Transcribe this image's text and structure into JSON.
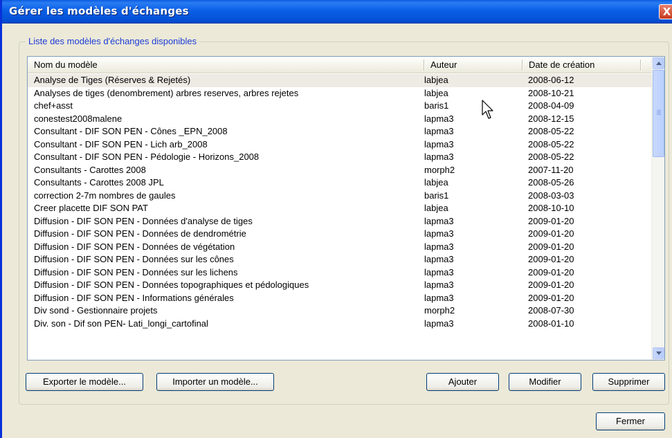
{
  "window": {
    "title": "Gérer les modèles d'échanges",
    "close_glyph": "X"
  },
  "group": {
    "legend": "Liste des modèles d'échanges disponibles"
  },
  "list": {
    "columns": [
      "Nom du modèle",
      "Auteur",
      "Date de création"
    ],
    "rows": [
      {
        "name": "Analyse de Tiges (Réserves & Rejetés)",
        "author": "labjea",
        "date": "2008-06-12",
        "selected": true
      },
      {
        "name": "Analyses de tiges (denombrement) arbres reserves, arbres rejetes",
        "author": "labjea",
        "date": "2008-10-21"
      },
      {
        "name": "chef+asst",
        "author": "baris1",
        "date": "2008-04-09"
      },
      {
        "name": "conestest2008malene",
        "author": "lapma3",
        "date": "2008-12-15"
      },
      {
        "name": "Consultant - DIF SON PEN - Cônes _EPN_2008",
        "author": "lapma3",
        "date": "2008-05-22"
      },
      {
        "name": "Consultant - DIF SON PEN - Lich arb_2008",
        "author": "lapma3",
        "date": "2008-05-22"
      },
      {
        "name": "Consultant - DIF SON PEN - Pédologie - Horizons_2008",
        "author": "lapma3",
        "date": "2008-05-22"
      },
      {
        "name": "Consultants - Carottes 2008",
        "author": "morph2",
        "date": "2007-11-20"
      },
      {
        "name": "Consultants - Carottes 2008 JPL",
        "author": "labjea",
        "date": "2008-05-26"
      },
      {
        "name": "correction 2-7m nombres de gaules",
        "author": "baris1",
        "date": "2008-03-03"
      },
      {
        "name": "Creer placette DIF SON PAT",
        "author": "labjea",
        "date": "2008-10-10"
      },
      {
        "name": "Diffusion -  DIF SON PEN - Données d'analyse de tiges",
        "author": "lapma3",
        "date": "2009-01-20"
      },
      {
        "name": "Diffusion -  DIF SON PEN - Données de dendrométrie",
        "author": "lapma3",
        "date": "2009-01-20"
      },
      {
        "name": "Diffusion -  DIF SON PEN - Données de végétation",
        "author": "lapma3",
        "date": "2009-01-20"
      },
      {
        "name": "Diffusion -  DIF SON PEN - Données sur les cônes",
        "author": "lapma3",
        "date": "2009-01-20"
      },
      {
        "name": "Diffusion -  DIF SON PEN - Données sur les lichens",
        "author": "lapma3",
        "date": "2009-01-20"
      },
      {
        "name": "Diffusion -  DIF SON PEN - Données topographiques et pédologiques",
        "author": "lapma3",
        "date": "2009-01-20"
      },
      {
        "name": "Diffusion -  DIF SON PEN - Informations générales",
        "author": "lapma3",
        "date": "2009-01-20"
      },
      {
        "name": "Div sond - Gestionnaire projets",
        "author": "morph2",
        "date": "2008-07-30"
      },
      {
        "name": "Div. son - Dif son PEN- Lati_longi_cartofinal",
        "author": "lapma3",
        "date": "2008-01-10"
      }
    ]
  },
  "buttons": {
    "export": "Exporter le modèle...",
    "import": "Importer un modèle...",
    "add": "Ajouter",
    "modify": "Modifier",
    "delete": "Supprimer",
    "close": "Fermer"
  },
  "icons": {
    "close": "close-icon",
    "scroll_up": "chevron-up-icon",
    "scroll_down": "chevron-down-icon",
    "cursor": "mouse-pointer-icon"
  },
  "colors": {
    "titlebar": "#0554d9",
    "legend_text": "#1c3bd6",
    "dialog_bg": "#ece9d8",
    "selected_row": "#eeeae4"
  }
}
